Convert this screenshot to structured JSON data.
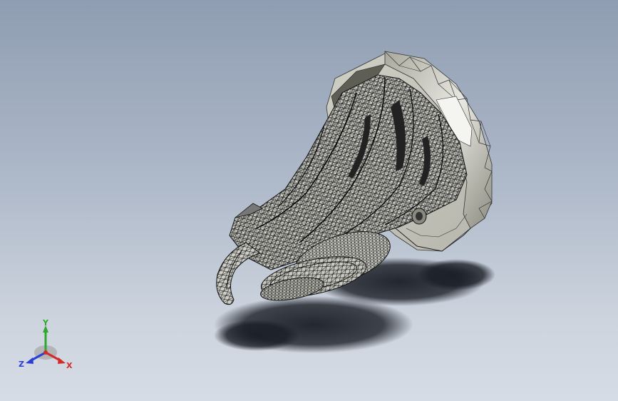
{
  "triad": {
    "x_label": "X",
    "y_label": "Y",
    "z_label": "Z"
  },
  "colors": {
    "background_top": "#8f9db2",
    "background_bottom": "#d6dce5",
    "x_axis": "#d42a2a",
    "y_axis": "#2fa82f",
    "z_axis": "#2a3fd4",
    "model_face": "#c8c8c0",
    "wireframe": "#111111",
    "shadow": "#1a1e26"
  }
}
